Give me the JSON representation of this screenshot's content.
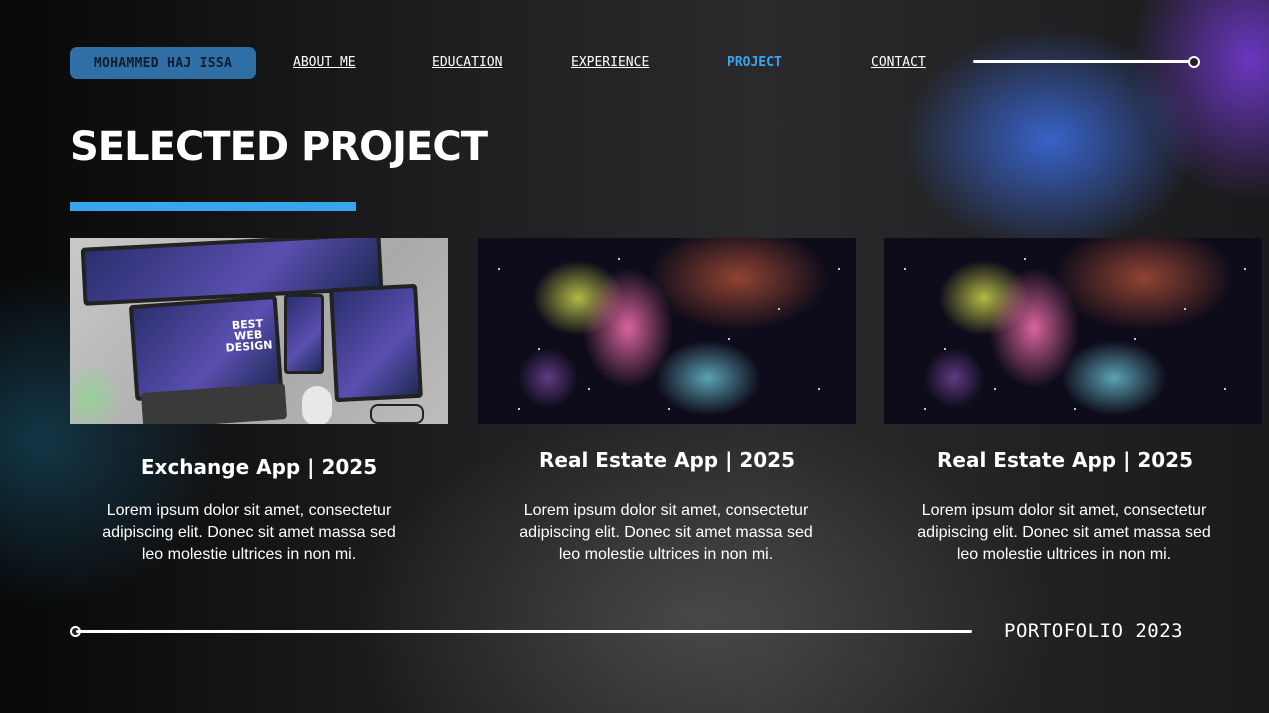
{
  "nav": {
    "name": "MOHAMMED HAJ ISSA",
    "links": [
      "ABOUT ME",
      "EDUCATION",
      "EXPERIENCE",
      "PROJECT",
      "CONTACT"
    ],
    "active": "PROJECT"
  },
  "section": {
    "title": "SELECTED PROJECT"
  },
  "cards": [
    {
      "image": "web-design-devices-image",
      "image_text": "BEST WEB DESIGN",
      "title": "Exchange App | 2025",
      "description": "Lorem ipsum dolor sit amet, consectetur adipiscing elit. Donec sit amet massa sed leo molestie ultrices in non mi."
    },
    {
      "image": "galaxy-nebula-image",
      "title": "Real Estate App | 2025",
      "description": "Lorem ipsum dolor sit amet, consectetur adipiscing elit. Donec sit amet massa sed leo molestie ultrices in non mi."
    },
    {
      "image": "galaxy-nebula-image",
      "title": "Real Estate App | 2025",
      "description": "Lorem ipsum dolor sit amet, consectetur adipiscing elit. Donec sit amet massa sed leo molestie ultrices in non mi."
    }
  ],
  "footer": {
    "text": "PORTOFOLIO 2023"
  },
  "colors": {
    "accent": "#3ba4ee",
    "name_badge": "#2f6fa6",
    "background": "#1c1c1e"
  }
}
